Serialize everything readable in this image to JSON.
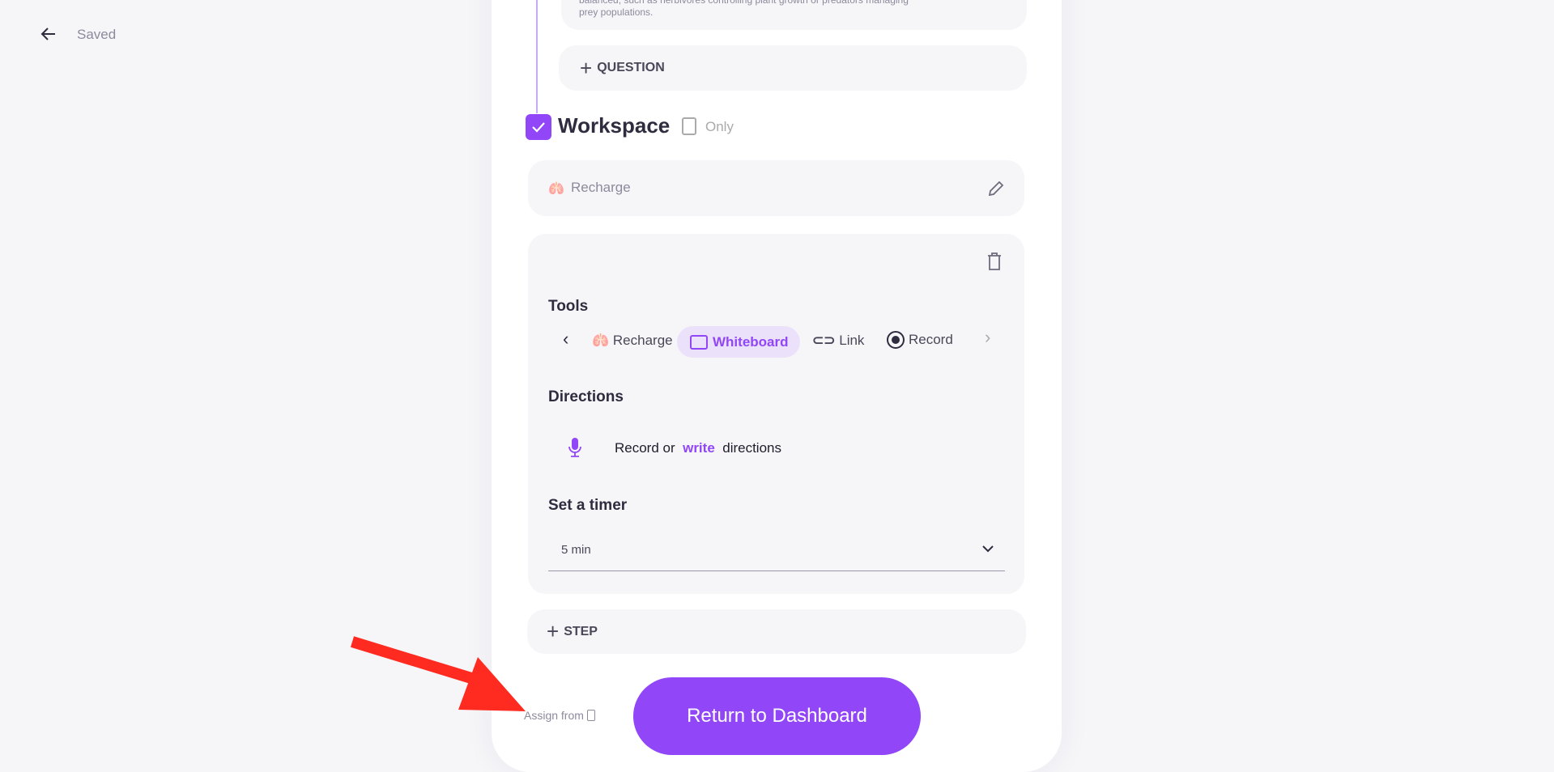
{
  "header": {
    "back_icon": "arrow-left-icon",
    "status": "Saved"
  },
  "question": {
    "text_tail": "balanced, such as herbivores controlling plant growth or predators managing",
    "text_last": "prey populations.",
    "add_label": "QUESTION"
  },
  "workspace": {
    "title": "Workspace",
    "checked": true,
    "only_label": "Only",
    "name": "Recharge"
  },
  "tools": {
    "heading": "Tools",
    "items": [
      {
        "label": "Recharge",
        "icon": "lungs-icon"
      },
      {
        "label": "Whiteboard",
        "icon": "whiteboard-icon",
        "selected": true
      },
      {
        "label": "Link",
        "icon": "link-icon"
      },
      {
        "label": "Record",
        "icon": "record-icon"
      }
    ]
  },
  "directions": {
    "heading": "Directions",
    "prefix": "Record or",
    "link": "write",
    "suffix": "directions"
  },
  "timer": {
    "heading": "Set a timer",
    "value": "5 min"
  },
  "step": {
    "add_label": "STEP"
  },
  "footer": {
    "assign_label": "Assign from",
    "return_label": "Return to Dashboard"
  },
  "colors": {
    "accent": "#9146f8",
    "annotation_arrow": "#ff2a20"
  }
}
